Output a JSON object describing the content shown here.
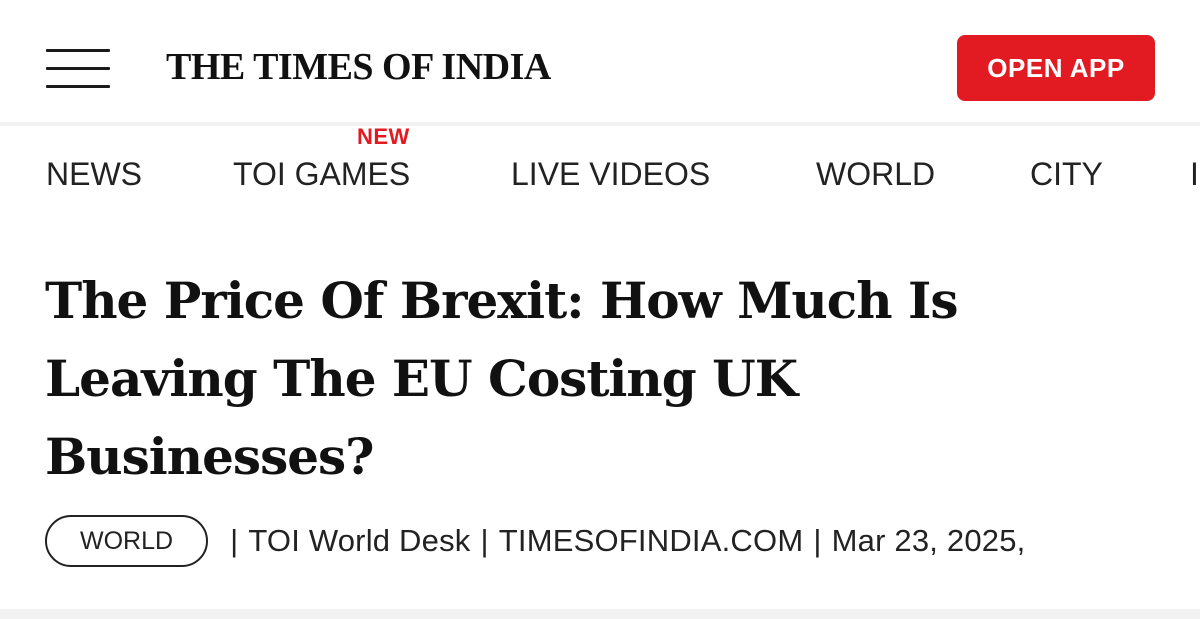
{
  "header": {
    "logo_text": "THE TIMES OF INDIA",
    "open_app_label": "OPEN APP",
    "menu_icon": "hamburger-menu-icon",
    "accent_color": "#e21b23"
  },
  "nav": {
    "items": [
      {
        "label": "NEWS"
      },
      {
        "label": "TOI GAMES",
        "badge": "NEW"
      },
      {
        "label": "LIVE VIDEOS"
      },
      {
        "label": "WORLD"
      },
      {
        "label": "CITY"
      },
      {
        "label": "I"
      }
    ]
  },
  "article": {
    "headline": "The Price Of Brexit: How Much Is Leaving The EU Costing UK Businesses?",
    "section": "WORLD",
    "separator": "|",
    "author": "TOI World Desk",
    "source": "TIMESOFINDIA.COM",
    "date": "Mar 23, 2025,"
  }
}
